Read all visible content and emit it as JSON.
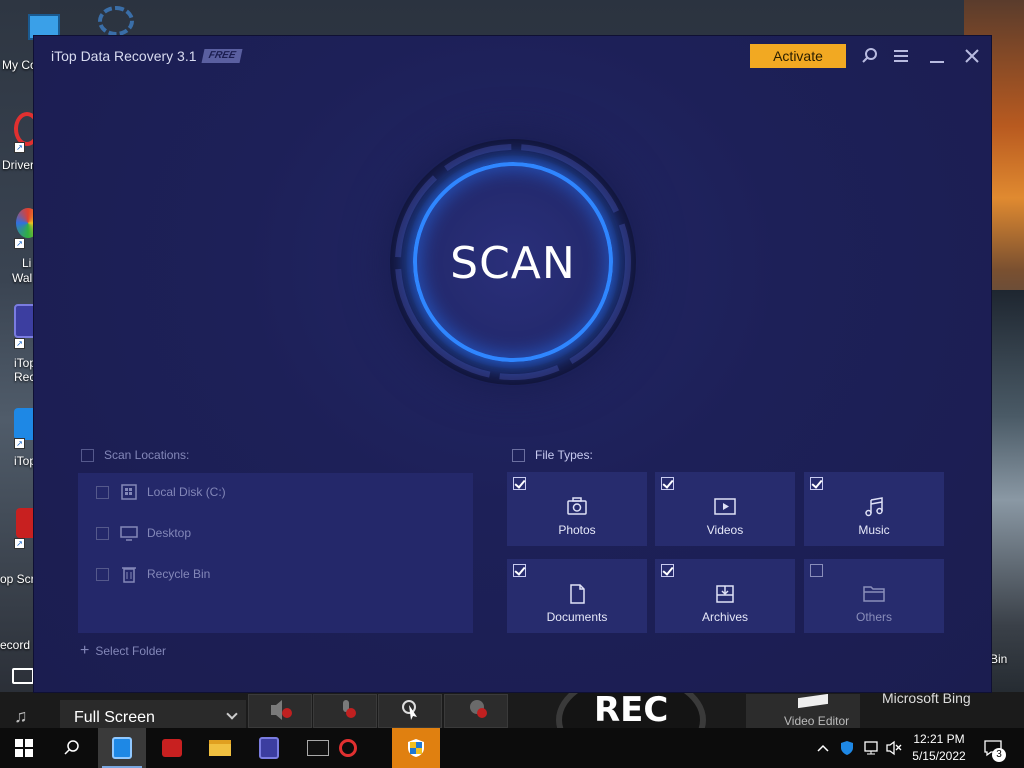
{
  "desktop": {
    "icons": [
      {
        "label": "My Co",
        "icon": "computer-icon"
      },
      {
        "label": "Driver",
        "icon": "driver-booster-icon"
      },
      {
        "label": "Li",
        "label2": "Wal",
        "icon": "lively-wallpaper-icon"
      },
      {
        "label": "iTop",
        "label2": "Reco",
        "icon": "itop-recovery-icon"
      },
      {
        "label": "iTop",
        "icon": "itop-vpn-icon"
      },
      {
        "label": "op Scr",
        "icon": "itop-screen-recorder-icon"
      },
      {
        "label": "ecord",
        "icon": "recording-icon"
      }
    ],
    "right_label": "Bin"
  },
  "recorder_bar": {
    "mode": "Full Screen",
    "rec_label": "REC",
    "video_editor": "Video Editor",
    "bing": "Microsoft Bing"
  },
  "app": {
    "title": "iTop Data Recovery 3.1",
    "badge": "FREE",
    "activate_label": "Activate",
    "scan_label": "SCAN",
    "scan_locations": {
      "header": "Scan Locations:",
      "checked": false,
      "items": [
        {
          "label": "Local Disk (C:)",
          "icon": "drive-icon",
          "checked": false
        },
        {
          "label": "Desktop",
          "icon": "monitor-icon",
          "checked": false
        },
        {
          "label": "Recycle Bin",
          "icon": "trash-icon",
          "checked": false
        }
      ],
      "select_folder": "Select Folder"
    },
    "file_types": {
      "header": "File Types:",
      "checked": false,
      "items": [
        {
          "label": "Photos",
          "icon": "camera-icon",
          "checked": true
        },
        {
          "label": "Videos",
          "icon": "video-icon",
          "checked": true
        },
        {
          "label": "Music",
          "icon": "music-icon",
          "checked": true
        },
        {
          "label": "Documents",
          "icon": "document-icon",
          "checked": true
        },
        {
          "label": "Archives",
          "icon": "archive-icon",
          "checked": true
        },
        {
          "label": "Others",
          "icon": "folder-icon",
          "checked": false
        }
      ]
    }
  },
  "taskbar": {
    "time": "12:21 PM",
    "date": "5/15/2022",
    "notification_count": "3"
  },
  "colors": {
    "app_bg": "#1d2058",
    "panel_bg": "#24286a",
    "tile_bg": "#272c6e",
    "accent_blue": "#2f86ff",
    "activate_orange": "#f2a922"
  }
}
